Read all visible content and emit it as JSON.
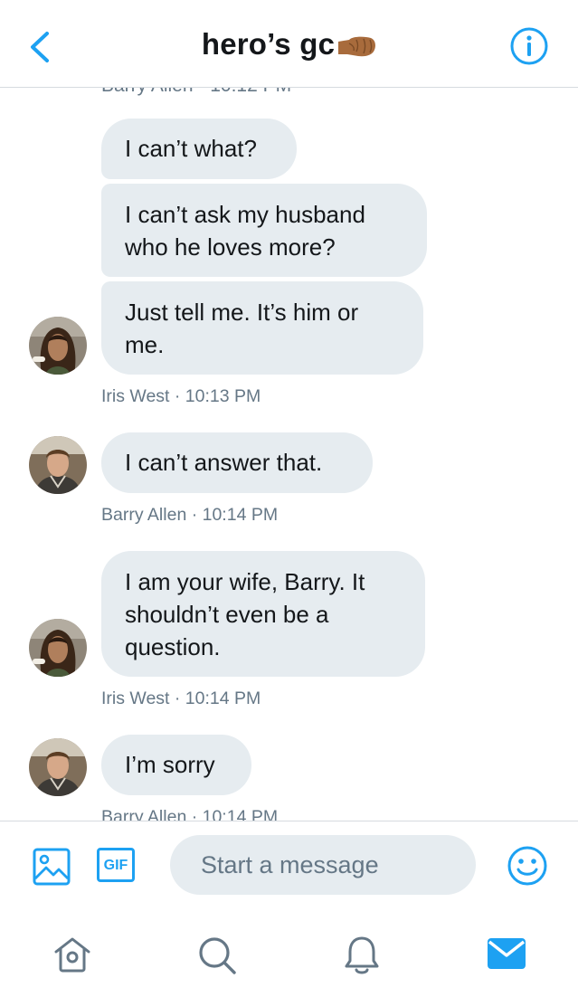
{
  "header": {
    "title": "hero’s gc",
    "back_icon": "chevron-left-icon",
    "info_icon": "info-circle-icon",
    "accent_color": "#1da1f2"
  },
  "thread": {
    "cut_meta": "Barry Allen · 10:12 PM",
    "messages": [
      {
        "text": "I can’t what?"
      },
      {
        "text_lines": [
          "I can’t ask my husband",
          "who he loves more?"
        ]
      },
      {
        "text_lines": [
          "Just tell me. It’s him or",
          "me."
        ]
      },
      {
        "meta": "Iris West · 10:13 PM"
      },
      {
        "text": "I can’t answer that."
      },
      {
        "meta": "Barry Allen · 10:14 PM"
      },
      {
        "text_lines": [
          "I am your wife, Barry. It",
          "shouldn’t even be a",
          "question."
        ]
      },
      {
        "meta": "Iris West · 10:14 PM"
      },
      {
        "text": "I’m sorry"
      },
      {
        "meta": "Barry Allen · 10:14 PM"
      }
    ]
  },
  "composer": {
    "placeholder": "Start a message",
    "gif_label": "GIF",
    "image_icon": "image-icon",
    "emoji_icon": "emoji-icon"
  },
  "tabbar": {
    "icons": [
      "home-icon",
      "search-icon",
      "notifications-icon",
      "messages-icon"
    ],
    "active": "messages-icon"
  }
}
